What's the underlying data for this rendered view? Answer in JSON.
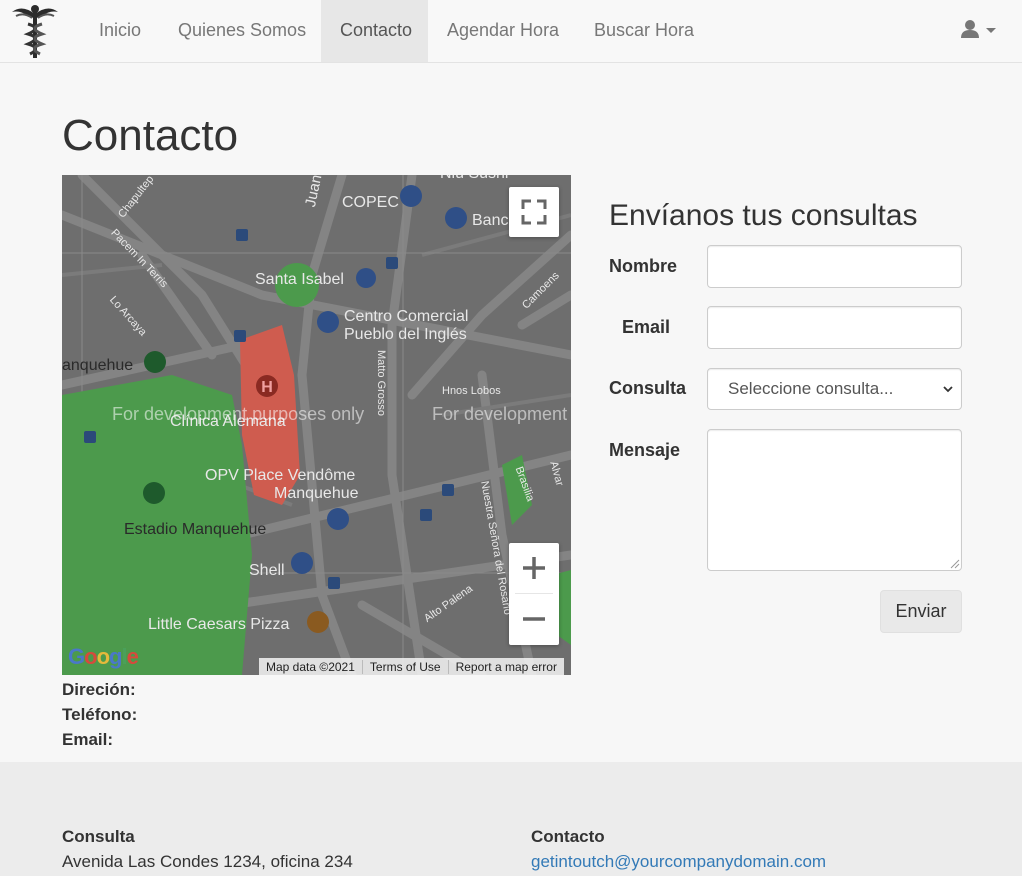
{
  "navbar": {
    "logo_icon": "caduceus-icon",
    "items": [
      {
        "label": "Inicio",
        "active": false
      },
      {
        "label": "Quienes Somos",
        "active": false
      },
      {
        "label": "Contacto",
        "active": true
      },
      {
        "label": "Agendar Hora",
        "active": false
      },
      {
        "label": "Buscar Hora",
        "active": false
      }
    ],
    "user_menu_icon": "user-icon"
  },
  "page": {
    "title": "Contacto"
  },
  "map": {
    "labels": {
      "niu_sushi": "Niu Sushi",
      "copec": "COPEC",
      "banco": "Banc",
      "juan_xxiii": "Juan XXIII",
      "chapultepec": "Chapultep",
      "pacem_in_terris": "Pacem In Terris",
      "santa_isabel": "Santa Isabel",
      "camoens": "Camoens",
      "lo_arcaya": "Lo Arcaya",
      "centro_comercial_1": "Centro Comercial",
      "centro_comercial_2": "Pueblo del Inglés",
      "manquehue": "anquehue",
      "matta_grosso": "Matto Grosso",
      "hnos_lobos": "Hnos Lobos",
      "clinica_alemana": "Clínica Alemana",
      "opv_1": "OPV Place Vendôme",
      "opv_2": "Manquehue",
      "brasilia": "Brasilia",
      "alvarez": "Alvar",
      "nuestra_senora": "Nuestra Señora del Rosario",
      "estadio": "Estadio Manquehue",
      "shell": "Shell",
      "alto_palena": "Alto Palena",
      "little_caesars": "Little Caesars Pizza"
    },
    "watermark": "For development purposes only",
    "watermark_partial": "For development",
    "fullscreen_icon": "fullscreen-icon",
    "zoom_in_icon": "zoom-in-icon",
    "zoom_out_icon": "zoom-out-icon",
    "google_logo": "Google",
    "footer": {
      "map_data": "Map data ©2021",
      "terms": "Terms of Use",
      "report": "Report a map error"
    }
  },
  "contact_info": {
    "address_label": "Direción:",
    "phone_label": "Teléfono:",
    "email_label": "Email:"
  },
  "form": {
    "heading": "Envíanos tus consultas",
    "name_label": "Nombre",
    "name_value": "",
    "email_label": "Email",
    "email_value": "",
    "query_label": "Consulta",
    "query_selected": "Seleccione consulta...",
    "message_label": "Mensaje",
    "message_value": "",
    "submit_label": "Enviar"
  },
  "footer": {
    "col1": {
      "heading": "Consulta",
      "text": "Avenida Las Condes 1234, oficina 234"
    },
    "col2": {
      "heading": "Contacto",
      "email": "getintoutch@yourcompanydomain.com"
    }
  },
  "colors": {
    "link": "#337ab7",
    "map_overlay": "#6d6d6d",
    "park": "#4c9a4c",
    "hospital": "#d9534f"
  }
}
